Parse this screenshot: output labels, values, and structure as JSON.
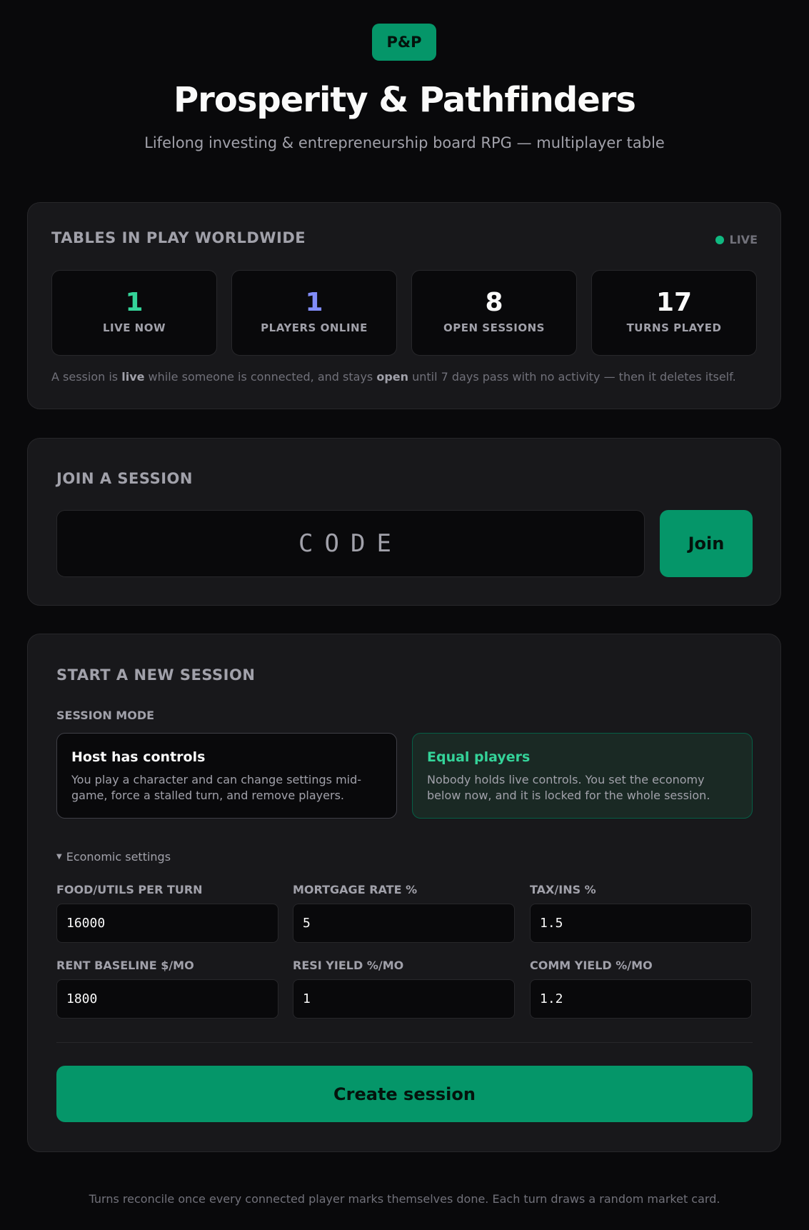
{
  "header": {
    "logo": "P&P",
    "title": "Prosperity & Pathfinders",
    "subtitle": "Lifelong investing & entrepreneurship board RPG — multiplayer table"
  },
  "stats": {
    "title": "TABLES IN PLAY WORLDWIDE",
    "live_label": "LIVE",
    "items": [
      {
        "value": "1",
        "label": "LIVE NOW",
        "color": "#34d399"
      },
      {
        "value": "1",
        "label": "PLAYERS ONLINE",
        "color": "#818cf8"
      },
      {
        "value": "8",
        "label": "OPEN SESSIONS",
        "color": "#fafafa"
      },
      {
        "value": "17",
        "label": "TURNS PLAYED",
        "color": "#fafafa"
      }
    ],
    "note": {
      "p1": "A session is ",
      "b1": "live",
      "p2": " while someone is connected, and stays ",
      "b2": "open",
      "p3": " until 7 days pass with no activity — then it deletes itself."
    }
  },
  "join": {
    "title": "JOIN A SESSION",
    "code_placeholder": "CODE",
    "code_value": "",
    "join_label": "Join"
  },
  "new_session": {
    "title": "START A NEW SESSION",
    "mode_label": "SESSION MODE",
    "modes": [
      {
        "title": "Host has controls",
        "desc": "You play a character and can change settings mid-game, force a stalled turn, and remove players.",
        "selected": false
      },
      {
        "title": "Equal players",
        "desc": "Nobody holds live controls. You set the economy below now, and it is locked for the whole session.",
        "selected": true
      }
    ],
    "econ_toggle": "Economic settings",
    "fields": [
      {
        "label": "FOOD/UTILS PER TURN",
        "value": "16000"
      },
      {
        "label": "MORTGAGE RATE %",
        "value": "5"
      },
      {
        "label": "TAX/INS %",
        "value": "1.5"
      },
      {
        "label": "RENT BASELINE $/MO",
        "value": "1800"
      },
      {
        "label": "RESI YIELD %/MO",
        "value": "1"
      },
      {
        "label": "COMM YIELD %/MO",
        "value": "1.2"
      }
    ],
    "create_label": "Create session"
  },
  "footer": "Turns reconcile once every connected player marks themselves done. Each turn draws a random market card.",
  "colors": {
    "accent": "#059669",
    "accent_text": "#34d399",
    "players_accent": "#818cf8"
  }
}
